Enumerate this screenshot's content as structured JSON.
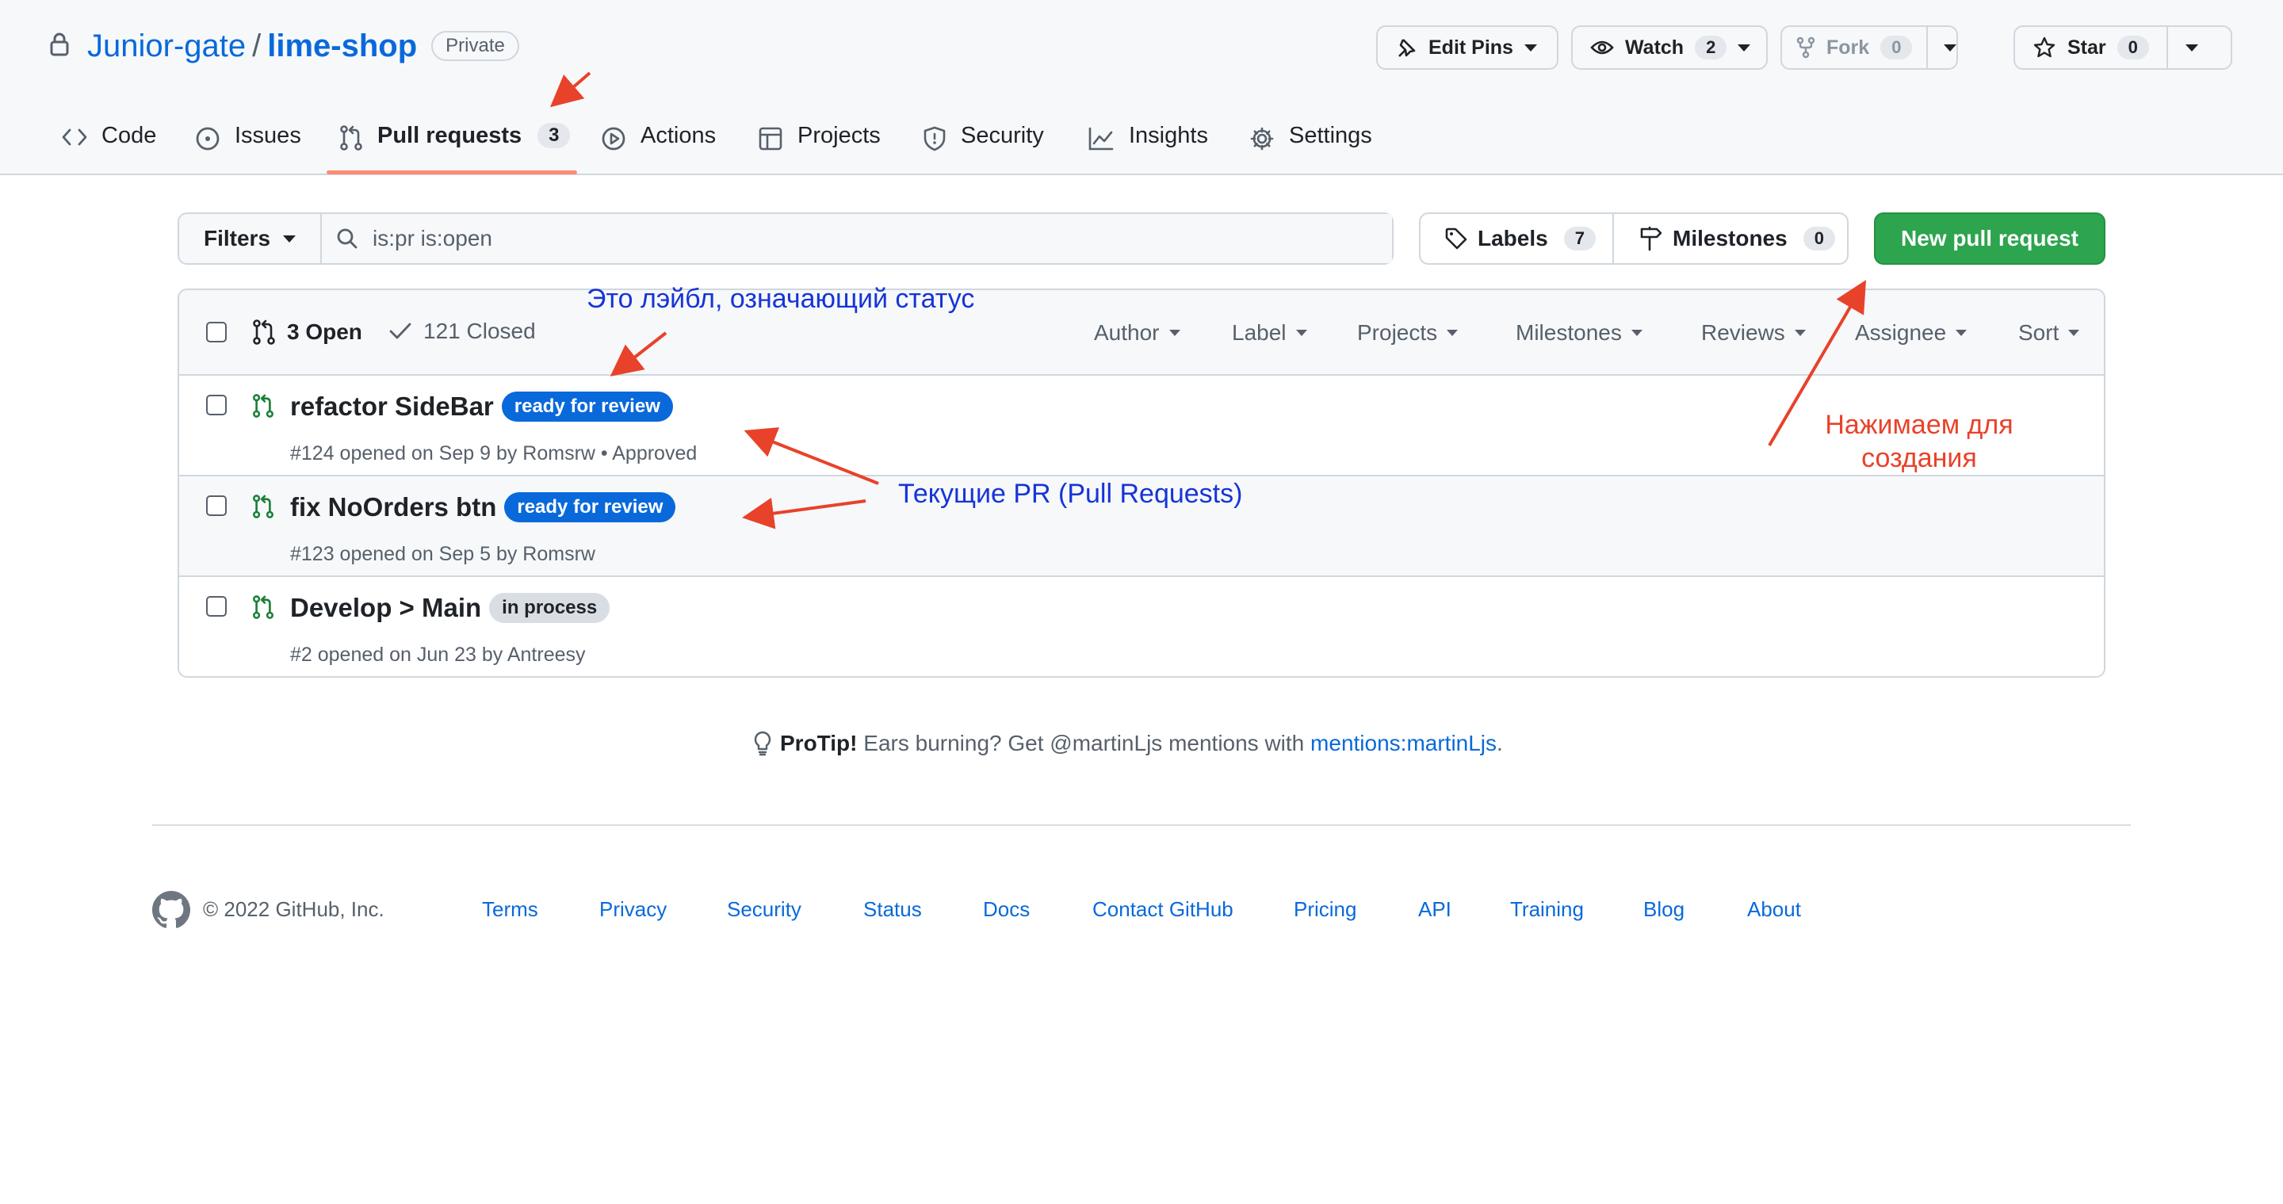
{
  "repo": {
    "owner": "Junior-gate",
    "separator": "/",
    "name": "lime-shop",
    "visibility": "Private"
  },
  "header_actions": {
    "edit_pins": "Edit Pins",
    "watch": {
      "label": "Watch",
      "count": "2"
    },
    "fork": {
      "label": "Fork",
      "count": "0"
    },
    "star": {
      "label": "Star",
      "count": "0"
    }
  },
  "tabs": [
    {
      "label": "Code",
      "icon": "code-icon"
    },
    {
      "label": "Issues",
      "icon": "issue-opened-icon"
    },
    {
      "label": "Pull requests",
      "icon": "git-pull-request-icon",
      "count": "3",
      "active": true
    },
    {
      "label": "Actions",
      "icon": "play-icon"
    },
    {
      "label": "Projects",
      "icon": "table-icon"
    },
    {
      "label": "Security",
      "icon": "shield-icon"
    },
    {
      "label": "Insights",
      "icon": "graph-icon"
    },
    {
      "label": "Settings",
      "icon": "gear-icon"
    }
  ],
  "toolbar": {
    "filters": "Filters",
    "search_value": "is:pr is:open",
    "labels": {
      "label": "Labels",
      "count": "7"
    },
    "milestones": {
      "label": "Milestones",
      "count": "0"
    },
    "new_pr": "New pull request"
  },
  "list": {
    "open": "3 Open",
    "closed": "121 Closed",
    "filters": [
      "Author",
      "Label",
      "Projects",
      "Milestones",
      "Reviews",
      "Assignee",
      "Sort"
    ],
    "rows": [
      {
        "title": "refactor SideBar",
        "label": "ready for review",
        "label_color": "#0969da",
        "label_text_color": "#ffffff",
        "meta": "#124 opened on Sep 9 by Romsrw • Approved"
      },
      {
        "title": "fix NoOrders btn",
        "label": "ready for review",
        "label_color": "#0969da",
        "label_text_color": "#ffffff",
        "meta": "#123 opened on Sep 5 by Romsrw"
      },
      {
        "title": "Develop > Main",
        "label": "in process",
        "label_color": "#d8dee4",
        "label_text_color": "#1f2328",
        "meta": "#2 opened on Jun 23 by Antreesy"
      }
    ]
  },
  "protip": {
    "bold": "ProTip!",
    "text": " Ears burning? Get @martinLjs mentions with ",
    "link": "mentions:martinLjs",
    "end": "."
  },
  "footer": {
    "copyright": "© 2022 GitHub, Inc.",
    "links": [
      "Terms",
      "Privacy",
      "Security",
      "Status",
      "Docs",
      "Contact GitHub",
      "Pricing",
      "API",
      "Training",
      "Blog",
      "About"
    ]
  },
  "annotations": {
    "label_note": "Это лэйбл, означающий статус",
    "pr_note": "Текущие PR (Pull Requests)",
    "create_note_1": "Нажимаем для",
    "create_note_2": "создания"
  },
  "colors": {
    "accent": "#0969da",
    "primary_button": "#2da44e",
    "open_pr_icon": "#1a7f37",
    "active_tab_underline": "#fd8c73",
    "annotation_blue": "#1734d6",
    "annotation_red": "#e8422a"
  }
}
